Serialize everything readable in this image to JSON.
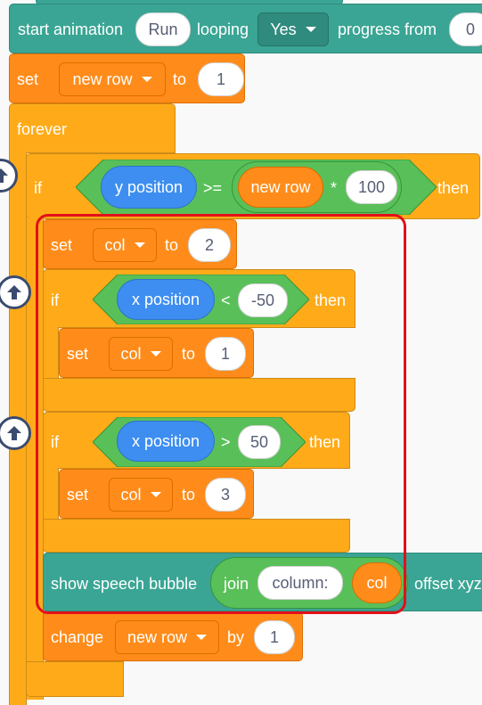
{
  "blocks": {
    "start_anim": {
      "label": "start animation",
      "anim_value": "Run",
      "looping_label": "looping",
      "looping_value": "Yes",
      "progress_label": "progress from",
      "progress_value": "0"
    },
    "set_row": {
      "set": "set",
      "var": "new row",
      "to": "to",
      "value": "1"
    },
    "forever": {
      "label": "forever"
    },
    "if_outer": {
      "if": "if",
      "lhs": "y position",
      "op": ">=",
      "rhs_var": "new row",
      "times": "*",
      "rhs_num": "100",
      "then": "then"
    },
    "set_col_default": {
      "set": "set",
      "var": "col",
      "to": "to",
      "value": "2"
    },
    "if_left": {
      "if": "if",
      "lhs": "x position",
      "op": "<",
      "rhs": "-50",
      "then": "then"
    },
    "set_col_left": {
      "set": "set",
      "var": "col",
      "to": "to",
      "value": "1"
    },
    "if_right": {
      "if": "if",
      "lhs": "x position",
      "op": ">",
      "rhs": "50",
      "then": "then"
    },
    "set_col_right": {
      "set": "set",
      "var": "col",
      "to": "to",
      "value": "3"
    },
    "speech": {
      "label": "show speech bubble",
      "join": "join",
      "text": "column:",
      "var": "col",
      "offset": "offset xyz"
    },
    "change_row": {
      "change": "change",
      "var": "new row",
      "by": "by",
      "value": "1"
    }
  },
  "colors": {
    "extension": "#3aa594",
    "variables": "#ff8c1a",
    "control": "#ffab19",
    "motion": "#3d8ef0",
    "operators": "#59c059",
    "highlight": "#e3101a"
  },
  "icons": {
    "collapse_buttons": [
      "arrow-up-icon",
      "arrow-up-icon",
      "arrow-up-icon"
    ]
  }
}
